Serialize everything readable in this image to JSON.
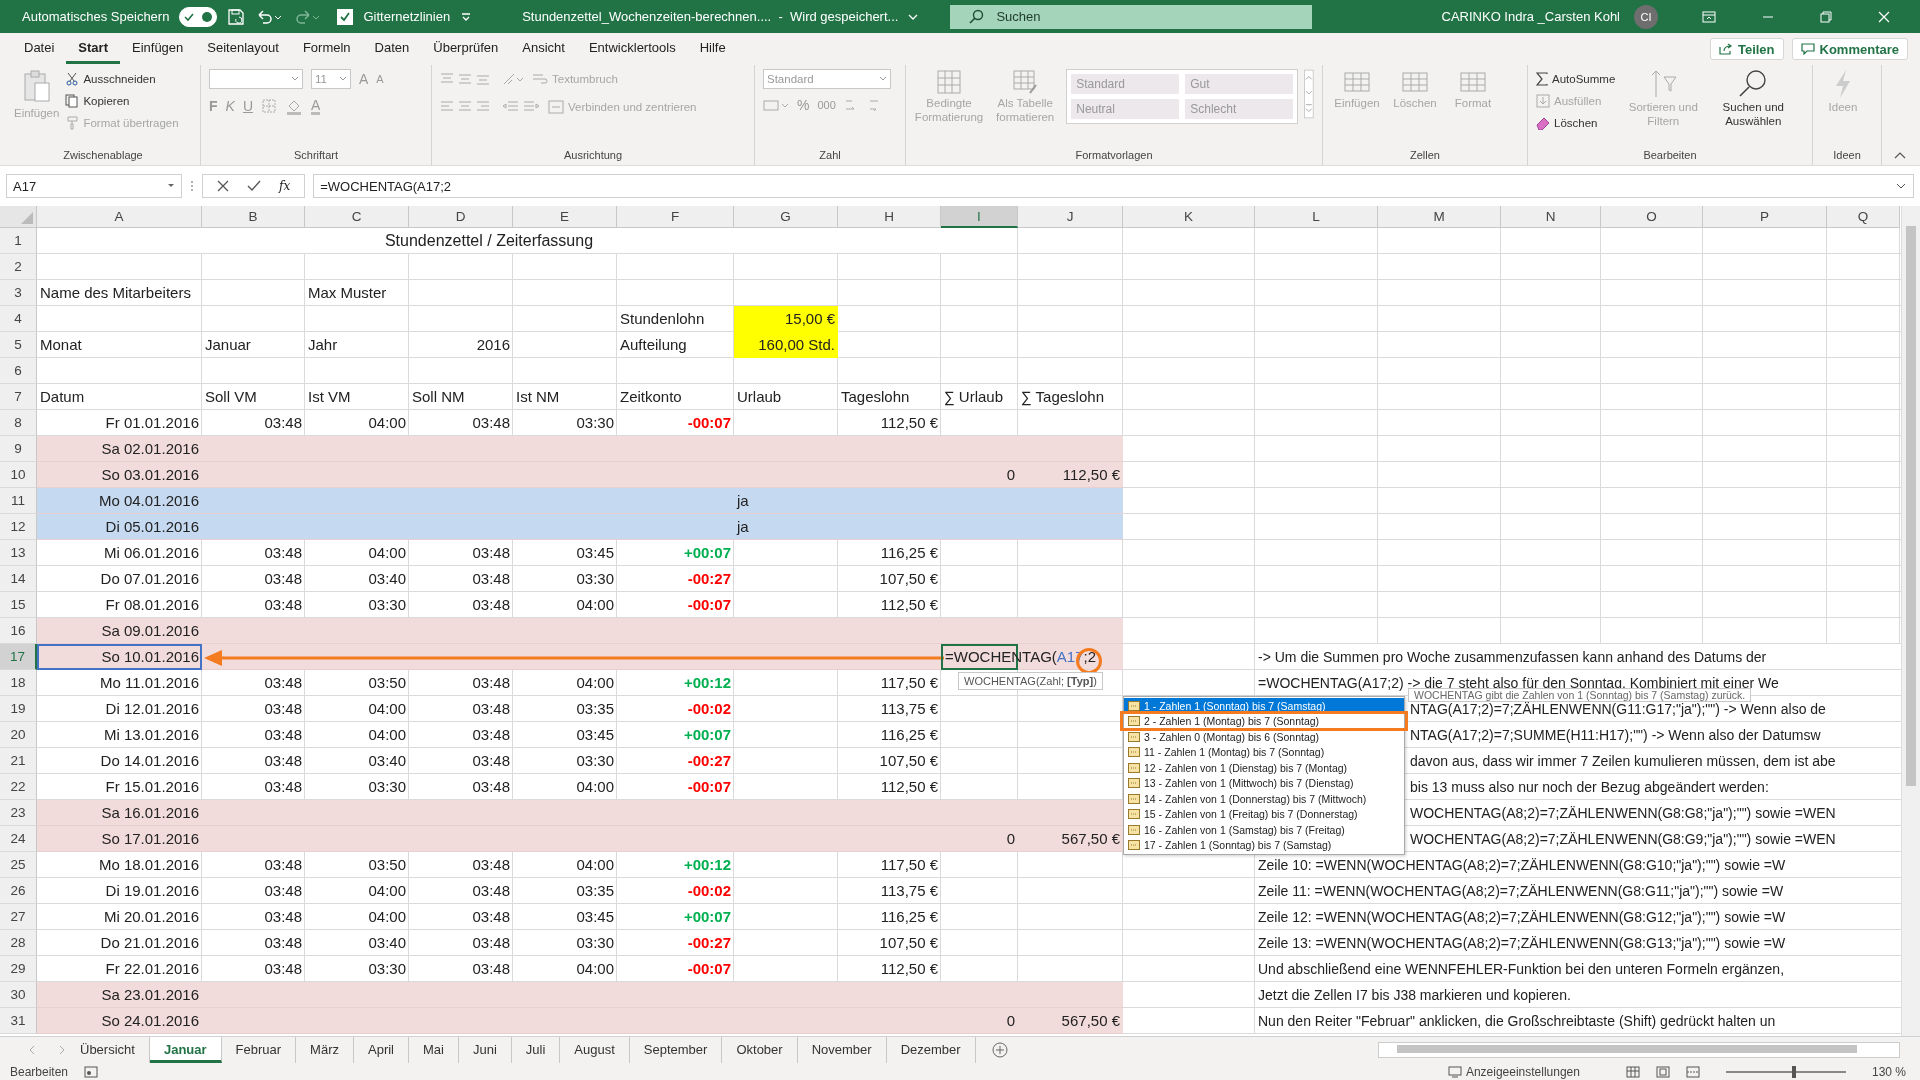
{
  "title_bar": {
    "autosave_label": "Automatisches Speichern",
    "autosave_on": true,
    "gridlines_label": "Gitternetzlinien",
    "gridlines_checked": true,
    "document_title": "Stundenzettel_Wochenzeiten-berechnen....  -  Wird gespeichert...",
    "search_placeholder": "Suchen",
    "user_name": "CARINKO Indra _Carsten Kohl",
    "user_initials": "CI"
  },
  "menu_tabs": [
    {
      "label": "Datei",
      "selected": false
    },
    {
      "label": "Start",
      "selected": true
    },
    {
      "label": "Einfügen",
      "selected": false
    },
    {
      "label": "Seitenlayout",
      "selected": false
    },
    {
      "label": "Formeln",
      "selected": false
    },
    {
      "label": "Daten",
      "selected": false
    },
    {
      "label": "Überprüfen",
      "selected": false
    },
    {
      "label": "Ansicht",
      "selected": false
    },
    {
      "label": "Entwicklertools",
      "selected": false
    },
    {
      "label": "Hilfe",
      "selected": false
    }
  ],
  "share_button": "Teilen",
  "comments_button": "Kommentare",
  "ribbon": {
    "clipboard": {
      "label": "Zwischenablage",
      "paste": "Einfügen",
      "cut": "Ausschneiden",
      "copy": "Kopieren",
      "format_painter": "Format übertragen"
    },
    "font": {
      "label": "Schriftart",
      "size": "11",
      "grow": "A",
      "shrink": "A",
      "bold": "F",
      "italic": "K",
      "underline": "U",
      "font_color_button": "A"
    },
    "alignment": {
      "label": "Ausrichtung",
      "wrap": "Textumbruch",
      "merge": "Verbinden und zentrieren"
    },
    "number": {
      "label": "Zahl",
      "format": "Standard",
      "percent": "%",
      "thousands": "000"
    },
    "styles": {
      "label": "Formatvorlagen",
      "conditional": "Bedingte Formatierung",
      "as_table": "Als Tabelle formatieren",
      "presets": [
        "Standard",
        "Gut",
        "Neutral",
        "Schlecht"
      ]
    },
    "cells": {
      "label": "Zellen",
      "buttons": [
        "Einfügen",
        "Löschen",
        "Format"
      ]
    },
    "editing": {
      "label": "Bearbeiten",
      "autosum": "AutoSumme",
      "fill": "Ausfüllen",
      "clear": "Löschen",
      "sort": "Sortieren und Filtern",
      "find": "Suchen und Auswählen"
    },
    "ideas": {
      "label": "Ideen",
      "button": "Ideen"
    }
  },
  "formula_bar": {
    "name_box": "A17",
    "function_label": "fx",
    "formula": "=WOCHENTAG(A17;2"
  },
  "sheet": {
    "columns": [
      {
        "label": "A",
        "selected": false
      },
      {
        "label": "B",
        "selected": false
      },
      {
        "label": "C",
        "selected": false
      },
      {
        "label": "D",
        "selected": false
      },
      {
        "label": "E",
        "selected": false
      },
      {
        "label": "F",
        "selected": false
      },
      {
        "label": "G",
        "selected": false
      },
      {
        "label": "H",
        "selected": false
      },
      {
        "label": "I",
        "selected": true
      },
      {
        "label": "J",
        "selected": false
      },
      {
        "label": "K",
        "selected": false
      },
      {
        "label": "L",
        "selected": false
      },
      {
        "label": "M",
        "selected": false
      },
      {
        "label": "N",
        "selected": false
      },
      {
        "label": "O",
        "selected": false
      },
      {
        "label": "P",
        "selected": false
      },
      {
        "label": "Q",
        "selected": false
      }
    ],
    "rows": [
      {
        "number": "1",
        "selected": false,
        "kind": "plain",
        "cells": {
          "a": {
            "kind": "title",
            "text": "Stundenzettel / Zeiterfassung"
          }
        }
      },
      {
        "number": "2",
        "selected": false,
        "kind": "plain"
      },
      {
        "number": "3",
        "selected": false,
        "kind": "plain",
        "cells": {
          "a": {
            "kind": "text",
            "text": "Name des Mitarbeiters"
          },
          "c": {
            "kind": "text",
            "text": "Max Muster"
          }
        }
      },
      {
        "number": "4",
        "selected": false,
        "kind": "plain",
        "cells": {
          "f": {
            "kind": "text",
            "text": "Stundenlohn"
          },
          "g": {
            "kind": "number",
            "text": "15,00 €",
            "highlight": true
          }
        }
      },
      {
        "number": "5",
        "selected": false,
        "kind": "plain",
        "cells": {
          "a": {
            "kind": "text",
            "text": "Monat"
          },
          "b": {
            "kind": "text",
            "text": "Januar"
          },
          "c": {
            "kind": "text",
            "text": "Jahr"
          },
          "d": {
            "kind": "number",
            "text": "2016"
          },
          "f": {
            "kind": "text",
            "text": "Aufteilung"
          },
          "g": {
            "kind": "number",
            "text": "160,00 Std.",
            "highlight": true
          }
        }
      },
      {
        "number": "6",
        "selected": false,
        "kind": "plain"
      },
      {
        "number": "7",
        "selected": false,
        "kind": "plain",
        "cells": {
          "a": {
            "kind": "text",
            "text": "Datum"
          },
          "b": {
            "kind": "text",
            "text": "Soll VM"
          },
          "c": {
            "kind": "text",
            "text": "Ist VM"
          },
          "d": {
            "kind": "text",
            "text": "Soll NM"
          },
          "e": {
            "kind": "text",
            "text": "Ist NM"
          },
          "f": {
            "kind": "text",
            "text": "Zeitkonto"
          },
          "g": {
            "kind": "text",
            "text": "Urlaub"
          },
          "h": {
            "kind": "text",
            "text": "Tageslohn"
          },
          "i": {
            "kind": "text",
            "text": "∑ Urlaub"
          },
          "j": {
            "kind": "text",
            "text": "∑ Tageslohn"
          }
        }
      },
      {
        "number": "8",
        "selected": false,
        "kind": "plain",
        "cells": {
          "a": {
            "kind": "number",
            "text": "Fr 01.01.2016"
          },
          "b": {
            "kind": "number",
            "text": "03:48"
          },
          "c": {
            "kind": "number",
            "text": "04:00"
          },
          "d": {
            "kind": "number",
            "text": "03:48"
          },
          "e": {
            "kind": "number",
            "text": "03:30"
          },
          "f": {
            "kind": "balance",
            "text": "-00:07",
            "color": "#ff0000"
          },
          "h": {
            "kind": "number",
            "text": "112,50 €"
          }
        }
      },
      {
        "number": "9",
        "selected": false,
        "kind": "weekend",
        "cells": {
          "a": {
            "kind": "number",
            "text": "Sa 02.01.2016"
          }
        }
      },
      {
        "number": "10",
        "selected": false,
        "kind": "weekend",
        "cells": {
          "a": {
            "kind": "number",
            "text": "So 03.01.2016"
          },
          "i": {
            "kind": "number",
            "text": "0"
          },
          "j": {
            "kind": "number",
            "text": "112,50 €"
          }
        }
      },
      {
        "number": "11",
        "selected": false,
        "kind": "holiday",
        "cells": {
          "a": {
            "kind": "number",
            "text": "Mo 04.01.2016"
          },
          "g": {
            "kind": "text",
            "text": "ja"
          }
        }
      },
      {
        "number": "12",
        "selected": false,
        "kind": "holiday",
        "cells": {
          "a": {
            "kind": "number",
            "text": "Di 05.01.2016"
          },
          "g": {
            "kind": "text",
            "text": "ja"
          }
        }
      },
      {
        "number": "13",
        "selected": false,
        "kind": "plain",
        "cells": {
          "a": {
            "kind": "number",
            "text": "Mi 06.01.2016"
          },
          "b": {
            "kind": "number",
            "text": "03:48"
          },
          "c": {
            "kind": "number",
            "text": "04:00"
          },
          "d": {
            "kind": "number",
            "text": "03:48"
          },
          "e": {
            "kind": "number",
            "text": "03:45"
          },
          "f": {
            "kind": "balance",
            "text": "+00:07",
            "color": "#00b050"
          },
          "h": {
            "kind": "number",
            "text": "116,25 €"
          }
        }
      },
      {
        "number": "14",
        "selected": false,
        "kind": "plain",
        "cells": {
          "a": {
            "kind": "number",
            "text": "Do 07.01.2016"
          },
          "b": {
            "kind": "number",
            "text": "03:48"
          },
          "c": {
            "kind": "number",
            "text": "03:40"
          },
          "d": {
            "kind": "number",
            "text": "03:48"
          },
          "e": {
            "kind": "number",
            "text": "03:30"
          },
          "f": {
            "kind": "balance",
            "text": "-00:27",
            "color": "#ff0000"
          },
          "h": {
            "kind": "number",
            "text": "107,50 €"
          }
        }
      },
      {
        "number": "15",
        "selected": false,
        "kind": "plain",
        "cells": {
          "a": {
            "kind": "number",
            "text": "Fr 08.01.2016"
          },
          "b": {
            "kind": "number",
            "text": "03:48"
          },
          "c": {
            "kind": "number",
            "text": "03:30"
          },
          "d": {
            "kind": "number",
            "text": "03:48"
          },
          "e": {
            "kind": "number",
            "text": "04:00"
          },
          "f": {
            "kind": "balance",
            "text": "-00:07",
            "color": "#ff0000"
          },
          "h": {
            "kind": "number",
            "text": "112,50 €"
          }
        }
      },
      {
        "number": "16",
        "selected": false,
        "kind": "weekend",
        "cells": {
          "a": {
            "kind": "number",
            "text": "Sa 09.01.2016"
          }
        }
      },
      {
        "number": "17",
        "selected": true,
        "kind": "weekend",
        "cells": {
          "a": {
            "kind": "number",
            "text": "So 10.01.2016",
            "referenced": true
          },
          "i": {
            "kind": "editing",
            "parts": [
              {
                "text": "=WOCHENTAG("
              },
              {
                "text": "A17",
                "color": "#4472c4"
              },
              {
                "text": ";2"
              }
            ]
          },
          "l": {
            "kind": "note",
            "text": "-> Um die Summen pro Woche zusammenzufassen kann anhand des Datums der"
          }
        }
      },
      {
        "number": "18",
        "selected": false,
        "kind": "plain",
        "cells": {
          "a": {
            "kind": "number",
            "text": "Mo 11.01.2016"
          },
          "b": {
            "kind": "number",
            "text": "03:48"
          },
          "c": {
            "kind": "number",
            "text": "03:50"
          },
          "d": {
            "kind": "number",
            "text": "03:48"
          },
          "e": {
            "kind": "number",
            "text": "04:00"
          },
          "f": {
            "kind": "balance",
            "text": "+00:12",
            "color": "#00b050"
          },
          "h": {
            "kind": "number",
            "text": "117,50 €"
          },
          "l": {
            "kind": "note",
            "text": "=WOCHENTAG(A17;2)  -> die 7 steht also für den Sonntag. Kombiniert mit einer We"
          }
        }
      },
      {
        "number": "19",
        "selected": false,
        "kind": "plain",
        "cells": {
          "a": {
            "kind": "number",
            "text": "Di 12.01.2016"
          },
          "b": {
            "kind": "number",
            "text": "03:48"
          },
          "c": {
            "kind": "number",
            "text": "04:00"
          },
          "d": {
            "kind": "number",
            "text": "03:48"
          },
          "e": {
            "kind": "number",
            "text": "03:35"
          },
          "f": {
            "kind": "balance",
            "text": "-00:02",
            "color": "#ff0000"
          },
          "h": {
            "kind": "number",
            "text": "113,75 €"
          },
          "l": {
            "kind": "note-cut",
            "text": "NTAG(A17;2)=7;ZÄHLENWENN(G11:G17;\"ja\");\"\")  -> Wenn also de"
          }
        }
      },
      {
        "number": "20",
        "selected": false,
        "kind": "plain",
        "cells": {
          "a": {
            "kind": "number",
            "text": "Mi 13.01.2016"
          },
          "b": {
            "kind": "number",
            "text": "03:48"
          },
          "c": {
            "kind": "number",
            "text": "04:00"
          },
          "d": {
            "kind": "number",
            "text": "03:48"
          },
          "e": {
            "kind": "number",
            "text": "03:45"
          },
          "f": {
            "kind": "balance",
            "text": "+00:07",
            "color": "#00b050"
          },
          "h": {
            "kind": "number",
            "text": "116,25 €"
          },
          "l": {
            "kind": "note-cut",
            "text": "NTAG(A17;2)=7;SUMME(H11:H17);\"\")  -> Wenn also der Datumsw"
          }
        }
      },
      {
        "number": "21",
        "selected": false,
        "kind": "plain",
        "cells": {
          "a": {
            "kind": "number",
            "text": "Do 14.01.2016"
          },
          "b": {
            "kind": "number",
            "text": "03:48"
          },
          "c": {
            "kind": "number",
            "text": "03:40"
          },
          "d": {
            "kind": "number",
            "text": "03:48"
          },
          "e": {
            "kind": "number",
            "text": "03:30"
          },
          "f": {
            "kind": "balance",
            "text": "-00:27",
            "color": "#ff0000"
          },
          "h": {
            "kind": "number",
            "text": "107,50 €"
          },
          "l": {
            "kind": "note-cut",
            "text": "davon aus, dass wir immer 7 Zeilen kumulieren müssen, dem ist abe"
          }
        }
      },
      {
        "number": "22",
        "selected": false,
        "kind": "plain",
        "cells": {
          "a": {
            "kind": "number",
            "text": "Fr 15.01.2016"
          },
          "b": {
            "kind": "number",
            "text": "03:48"
          },
          "c": {
            "kind": "number",
            "text": "03:30"
          },
          "d": {
            "kind": "number",
            "text": "03:48"
          },
          "e": {
            "kind": "number",
            "text": "04:00"
          },
          "f": {
            "kind": "balance",
            "text": "-00:07",
            "color": "#ff0000"
          },
          "h": {
            "kind": "number",
            "text": "112,50 €"
          },
          "l": {
            "kind": "note-cut",
            "text": "bis 13 muss also nur noch der Bezug abgeändert werden:"
          }
        }
      },
      {
        "number": "23",
        "selected": false,
        "kind": "weekend",
        "cells": {
          "a": {
            "kind": "number",
            "text": "Sa 16.01.2016"
          },
          "l": {
            "kind": "note-cut",
            "text": "WOCHENTAG(A8;2)=7;ZÄHLENWENN(G8:G8;\"ja\");\"\") sowie =WEN"
          }
        }
      },
      {
        "number": "24",
        "selected": false,
        "kind": "weekend",
        "cells": {
          "a": {
            "kind": "number",
            "text": "So 17.01.2016"
          },
          "i": {
            "kind": "number",
            "text": "0"
          },
          "j": {
            "kind": "number",
            "text": "567,50 €"
          },
          "l": {
            "kind": "note-cut",
            "text": "WOCHENTAG(A8;2)=7;ZÄHLENWENN(G8:G9;\"ja\");\"\") sowie =WEN"
          }
        }
      },
      {
        "number": "25",
        "selected": false,
        "kind": "plain",
        "cells": {
          "a": {
            "kind": "number",
            "text": "Mo 18.01.2016"
          },
          "b": {
            "kind": "number",
            "text": "03:48"
          },
          "c": {
            "kind": "number",
            "text": "03:50"
          },
          "d": {
            "kind": "number",
            "text": "03:48"
          },
          "e": {
            "kind": "number",
            "text": "04:00"
          },
          "f": {
            "kind": "balance",
            "text": "+00:12",
            "color": "#00b050"
          },
          "h": {
            "kind": "number",
            "text": "117,50 €"
          },
          "l": {
            "kind": "note",
            "text": "Zeile 10: =WENN(WOCHENTAG(A8;2)=7;ZÄHLENWENN(G8:G10;\"ja\");\"\") sowie =W"
          }
        }
      },
      {
        "number": "26",
        "selected": false,
        "kind": "plain",
        "cells": {
          "a": {
            "kind": "number",
            "text": "Di 19.01.2016"
          },
          "b": {
            "kind": "number",
            "text": "03:48"
          },
          "c": {
            "kind": "number",
            "text": "04:00"
          },
          "d": {
            "kind": "number",
            "text": "03:48"
          },
          "e": {
            "kind": "number",
            "text": "03:35"
          },
          "f": {
            "kind": "balance",
            "text": "-00:02",
            "color": "#ff0000"
          },
          "h": {
            "kind": "number",
            "text": "113,75 €"
          },
          "l": {
            "kind": "note",
            "text": "Zeile 11: =WENN(WOCHENTAG(A8;2)=7;ZÄHLENWENN(G8:G11;\"ja\");\"\") sowie =W"
          }
        }
      },
      {
        "number": "27",
        "selected": false,
        "kind": "plain",
        "cells": {
          "a": {
            "kind": "number",
            "text": "Mi 20.01.2016"
          },
          "b": {
            "kind": "number",
            "text": "03:48"
          },
          "c": {
            "kind": "number",
            "text": "04:00"
          },
          "d": {
            "kind": "number",
            "text": "03:48"
          },
          "e": {
            "kind": "number",
            "text": "03:45"
          },
          "f": {
            "kind": "balance",
            "text": "+00:07",
            "color": "#00b050"
          },
          "h": {
            "kind": "number",
            "text": "116,25 €"
          },
          "l": {
            "kind": "note",
            "text": "Zeile 12: =WENN(WOCHENTAG(A8;2)=7;ZÄHLENWENN(G8:G12;\"ja\");\"\") sowie =W"
          }
        }
      },
      {
        "number": "28",
        "selected": false,
        "kind": "plain",
        "cells": {
          "a": {
            "kind": "number",
            "text": "Do 21.01.2016"
          },
          "b": {
            "kind": "number",
            "text": "03:48"
          },
          "c": {
            "kind": "number",
            "text": "03:40"
          },
          "d": {
            "kind": "number",
            "text": "03:48"
          },
          "e": {
            "kind": "number",
            "text": "03:30"
          },
          "f": {
            "kind": "balance",
            "text": "-00:27",
            "color": "#ff0000"
          },
          "h": {
            "kind": "number",
            "text": "107,50 €"
          },
          "l": {
            "kind": "note",
            "text": "Zeile 13: =WENN(WOCHENTAG(A8;2)=7;ZÄHLENWENN(G8:G13;\"ja\");\"\") sowie =W"
          }
        }
      },
      {
        "number": "29",
        "selected": false,
        "kind": "plain",
        "cells": {
          "a": {
            "kind": "number",
            "text": "Fr 22.01.2016"
          },
          "b": {
            "kind": "number",
            "text": "03:48"
          },
          "c": {
            "kind": "number",
            "text": "03:30"
          },
          "d": {
            "kind": "number",
            "text": "03:48"
          },
          "e": {
            "kind": "number",
            "text": "04:00"
          },
          "f": {
            "kind": "balance",
            "text": "-00:07",
            "color": "#ff0000"
          },
          "h": {
            "kind": "number",
            "text": "112,50 €"
          },
          "l": {
            "kind": "note",
            "text": "Und abschließend eine WENNFEHLER-Funktion bei den unteren Formeln ergänzen,"
          }
        }
      },
      {
        "number": "30",
        "selected": false,
        "kind": "weekend",
        "cells": {
          "a": {
            "kind": "number",
            "text": "Sa 23.01.2016"
          },
          "l": {
            "kind": "note",
            "text": "Jetzt die Zellen I7 bis J38 markieren und kopieren."
          }
        }
      },
      {
        "number": "31",
        "selected": false,
        "kind": "weekend",
        "cells": {
          "a": {
            "kind": "number",
            "text": "So 24.01.2016"
          },
          "i": {
            "kind": "number",
            "text": "0"
          },
          "j": {
            "kind": "number",
            "text": "567,50 €"
          },
          "l": {
            "kind": "note",
            "text": "Nun den Reiter \"Februar\" anklicken, die Großschreibtaste (Shift) gedrückt halten un"
          }
        }
      }
    ]
  },
  "syntax_tooltip": "WOCHENTAG(Zahl; **[Typ]**)",
  "autocomplete": [
    {
      "label": "1 - Zahlen 1 (Sonntag) bis 7 (Samstag)",
      "selected": true
    },
    {
      "label": "2 - Zahlen 1 (Montag) bis 7 (Sonntag)",
      "selected": false
    },
    {
      "label": "3 - Zahlen 0 (Montag) bis 6 (Sonntag)",
      "selected": false
    },
    {
      "label": "11 - Zahlen 1 (Montag) bis 7 (Sonntag)",
      "selected": false
    },
    {
      "label": "12 - Zahlen von 1 (Dienstag) bis 7 (Montag)",
      "selected": false
    },
    {
      "label": "13 - Zahlen von 1 (Mittwoch) bis 7 (Dienstag)",
      "selected": false
    },
    {
      "label": "14 - Zahlen von 1 (Donnerstag) bis 7 (Mittwoch)",
      "selected": false
    },
    {
      "label": "15 - Zahlen von 1 (Freitag) bis 7 (Donnerstag)",
      "selected": false
    },
    {
      "label": "16 - Zahlen von 1 (Samstag) bis 7 (Freitag)",
      "selected": false
    },
    {
      "label": "17 - Zahlen 1 (Sonntag) bis 7 (Samstag)",
      "selected": false
    }
  ],
  "description_tooltip": "WOCHENTAG gibt die Zahlen von 1 (Sonntag) bis 7 (Samstag) zurück.",
  "sheet_tabs": [
    {
      "label": "Übersicht",
      "selected": false
    },
    {
      "label": "Januar",
      "selected": true
    },
    {
      "label": "Februar",
      "selected": false
    },
    {
      "label": "März",
      "selected": false
    },
    {
      "label": "April",
      "selected": false
    },
    {
      "label": "Mai",
      "selected": false
    },
    {
      "label": "Juni",
      "selected": false
    },
    {
      "label": "Juli",
      "selected": false
    },
    {
      "label": "August",
      "selected": false
    },
    {
      "label": "September",
      "selected": false
    },
    {
      "label": "Oktober",
      "selected": false
    },
    {
      "label": "November",
      "selected": false
    },
    {
      "label": "Dezember",
      "selected": false
    }
  ],
  "status_bar": {
    "mode": "Bearbeiten",
    "display_settings": "Anzeigeeinstellungen",
    "zoom_slider": {
      "level": 0.57
    },
    "zoom": "130 %"
  }
}
